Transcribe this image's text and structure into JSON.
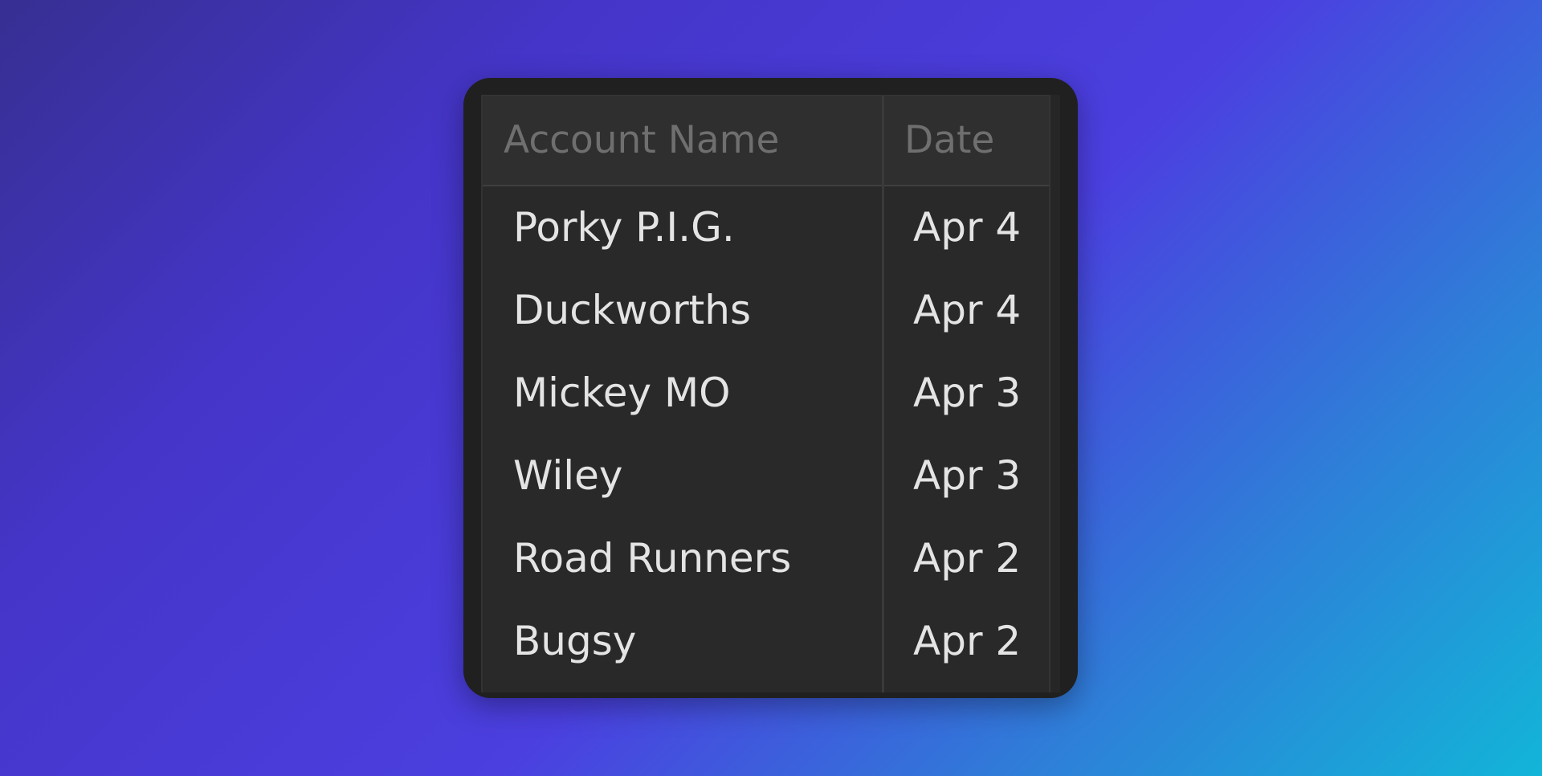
{
  "table": {
    "columns": [
      "Account Name",
      "Date"
    ],
    "rows": [
      {
        "account_name": "Porky P.I.G.",
        "date": "Apr 4"
      },
      {
        "account_name": "Duckworths",
        "date": "Apr 4"
      },
      {
        "account_name": "Mickey MO",
        "date": "Apr 3"
      },
      {
        "account_name": "Wiley",
        "date": "Apr 3"
      },
      {
        "account_name": "Road Runners",
        "date": "Apr 2"
      },
      {
        "account_name": "Bugsy",
        "date": "Apr 2"
      }
    ]
  },
  "colors": {
    "background_start": "#372f92",
    "background_mid": "#4b3fe0",
    "background_end": "#12b5d8",
    "panel": "#202020",
    "table": "#292929",
    "header": "#2f2f2f",
    "header_text": "#6f6f6f",
    "cell_text": "#e4e4e4"
  }
}
